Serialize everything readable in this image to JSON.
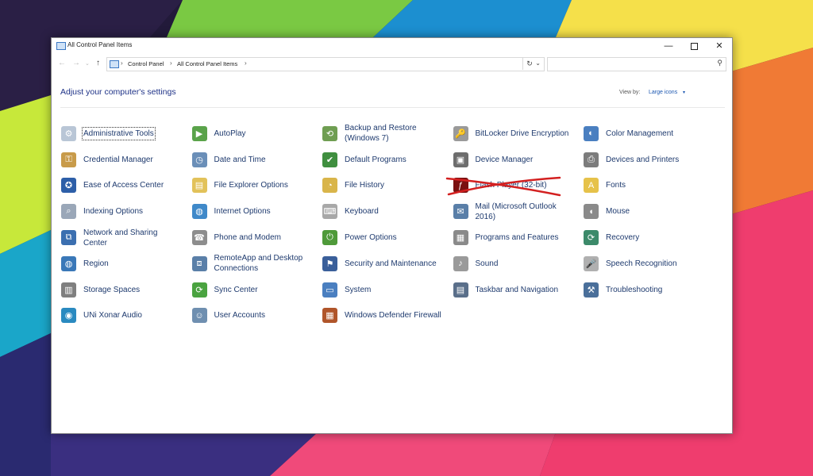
{
  "window": {
    "title": "All Control Panel Items",
    "controls": {
      "minimize": "—",
      "maximize": "",
      "close": "✕"
    }
  },
  "nav": {
    "back": "←",
    "forward": "→",
    "recent": "⌄",
    "up": "↑",
    "breadcrumbs": [
      "Control Panel",
      "All Control Panel Items"
    ],
    "separator": "›",
    "dropdown": "⌄",
    "refresh": "↻",
    "search_placeholder": "",
    "search_icon": "⚲"
  },
  "content": {
    "heading": "Adjust your computer's settings",
    "view_by_label": "View by:",
    "view_by_value": "Large icons",
    "view_caret": "▾"
  },
  "colors": {
    "link_text": "#1e3a6e",
    "heading": "#1e3287",
    "accent": "#1a56b0",
    "crossout": "#d32020"
  },
  "items": [
    {
      "label": "Administrative Tools",
      "icon": "admin-tools-icon",
      "glyph": "⚙",
      "bg": "#b9c6d6"
    },
    {
      "label": "AutoPlay",
      "icon": "autoplay-icon",
      "glyph": "▶",
      "bg": "#5aa34a"
    },
    {
      "label": "Backup and Restore (Windows 7)",
      "icon": "backup-restore-icon",
      "glyph": "⟲",
      "bg": "#6f9e52"
    },
    {
      "label": "BitLocker Drive Encryption",
      "icon": "bitlocker-icon",
      "glyph": "🔑",
      "bg": "#9a9a9a"
    },
    {
      "label": "Color Management",
      "icon": "color-management-icon",
      "glyph": "◐",
      "bg": "#4a7fc0"
    },
    {
      "label": "Credential Manager",
      "icon": "credential-manager-icon",
      "glyph": "⚿",
      "bg": "#c89b4a"
    },
    {
      "label": "Date and Time",
      "icon": "date-time-icon",
      "glyph": "◷",
      "bg": "#6b8fb8"
    },
    {
      "label": "Default Programs",
      "icon": "default-programs-icon",
      "glyph": "✔",
      "bg": "#3f8f3f"
    },
    {
      "label": "Device Manager",
      "icon": "device-manager-icon",
      "glyph": "▣",
      "bg": "#6d6d6d"
    },
    {
      "label": "Devices and Printers",
      "icon": "devices-printers-icon",
      "glyph": "⎙",
      "bg": "#7c7c7c"
    },
    {
      "label": "Ease of Access Center",
      "icon": "ease-of-access-icon",
      "glyph": "✪",
      "bg": "#2d5fa8"
    },
    {
      "label": "File Explorer Options",
      "icon": "file-explorer-options-icon",
      "glyph": "▤",
      "bg": "#e2c25a"
    },
    {
      "label": "File History",
      "icon": "file-history-icon",
      "glyph": "◔",
      "bg": "#d9b54a"
    },
    {
      "label": "Flash Player (32-bit)",
      "icon": "flash-player-icon",
      "glyph": "ƒ",
      "bg": "#7a1010",
      "crossed": true
    },
    {
      "label": "Fonts",
      "icon": "fonts-icon",
      "glyph": "A",
      "bg": "#e6c24a"
    },
    {
      "label": "Indexing Options",
      "icon": "indexing-options-icon",
      "glyph": "⌕",
      "bg": "#9aa7b8"
    },
    {
      "label": "Internet Options",
      "icon": "internet-options-icon",
      "glyph": "◍",
      "bg": "#3f89c9"
    },
    {
      "label": "Keyboard",
      "icon": "keyboard-icon",
      "glyph": "⌨",
      "bg": "#a8a8a8"
    },
    {
      "label": "Mail (Microsoft Outlook 2016)",
      "icon": "mail-icon",
      "glyph": "✉",
      "bg": "#5a7fa8"
    },
    {
      "label": "Mouse",
      "icon": "mouse-icon",
      "glyph": "◖",
      "bg": "#8a8a8a"
    },
    {
      "label": "Network and Sharing Center",
      "icon": "network-sharing-icon",
      "glyph": "⧉",
      "bg": "#3b6fb0"
    },
    {
      "label": "Phone and Modem",
      "icon": "phone-modem-icon",
      "glyph": "☎",
      "bg": "#8d8d8d"
    },
    {
      "label": "Power Options",
      "icon": "power-options-icon",
      "glyph": "⏻",
      "bg": "#4f9a3a"
    },
    {
      "label": "Programs and Features",
      "icon": "programs-features-icon",
      "glyph": "▦",
      "bg": "#8a8a8a"
    },
    {
      "label": "Recovery",
      "icon": "recovery-icon",
      "glyph": "⟳",
      "bg": "#3c8a6a"
    },
    {
      "label": "Region",
      "icon": "region-icon",
      "glyph": "◍",
      "bg": "#3a78b8"
    },
    {
      "label": "RemoteApp and Desktop Connections",
      "icon": "remoteapp-icon",
      "glyph": "⧈",
      "bg": "#5a7fa8"
    },
    {
      "label": "Security and Maintenance",
      "icon": "security-maintenance-icon",
      "glyph": "⚑",
      "bg": "#3a5f9a"
    },
    {
      "label": "Sound",
      "icon": "sound-icon",
      "glyph": "♪",
      "bg": "#9a9a9a"
    },
    {
      "label": "Speech Recognition",
      "icon": "speech-recognition-icon",
      "glyph": "🎤",
      "bg": "#b0b0b0"
    },
    {
      "label": "Storage Spaces",
      "icon": "storage-spaces-icon",
      "glyph": "▥",
      "bg": "#7f7f7f"
    },
    {
      "label": "Sync Center",
      "icon": "sync-center-icon",
      "glyph": "⟳",
      "bg": "#4aa340"
    },
    {
      "label": "System",
      "icon": "system-icon",
      "glyph": "▭",
      "bg": "#4a7fc0"
    },
    {
      "label": "Taskbar and Navigation",
      "icon": "taskbar-navigation-icon",
      "glyph": "▤",
      "bg": "#5a6f8a"
    },
    {
      "label": "Troubleshooting",
      "icon": "troubleshooting-icon",
      "glyph": "⚒",
      "bg": "#4a6f9a"
    },
    {
      "label": "UNi Xonar Audio",
      "icon": "xonar-audio-icon",
      "glyph": "◉",
      "bg": "#2a8ac0"
    },
    {
      "label": "User Accounts",
      "icon": "user-accounts-icon",
      "glyph": "☺",
      "bg": "#6f8fb0"
    },
    {
      "label": "Windows Defender Firewall",
      "icon": "firewall-icon",
      "glyph": "▦",
      "bg": "#b0552a"
    }
  ]
}
